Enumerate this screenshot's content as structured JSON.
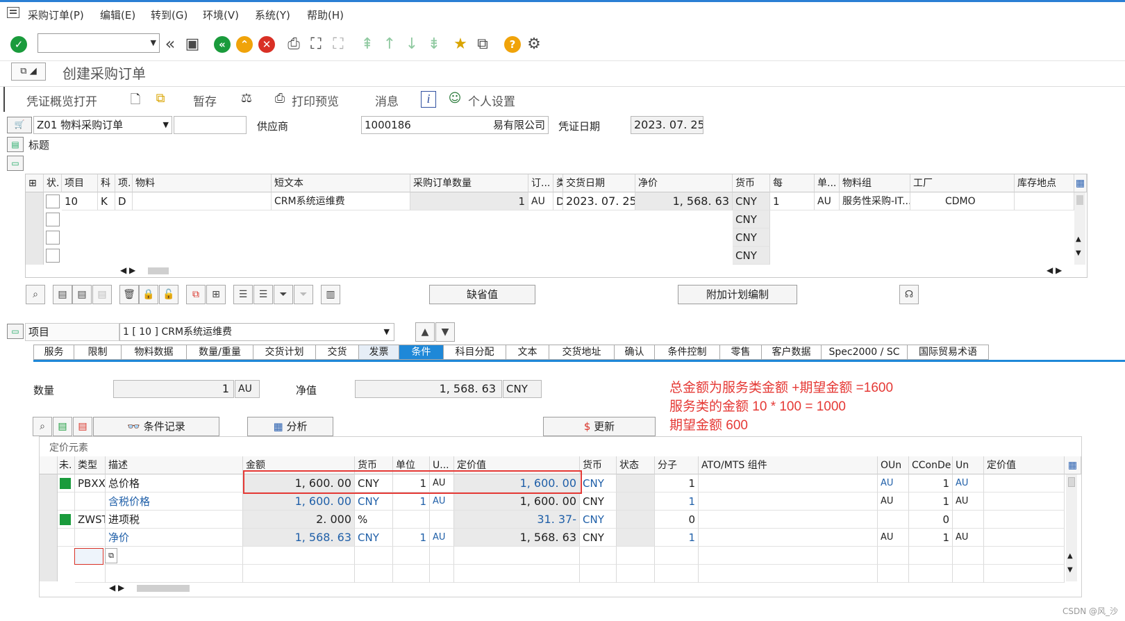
{
  "menu": [
    "采购订单(P)",
    "编辑(E)",
    "转到(G)",
    "环境(V)",
    "系统(Y)",
    "帮助(H)"
  ],
  "title": "创建采购订单",
  "appbar": {
    "overview": "凭证概览打开",
    "hold": "暂存",
    "print_preview": "打印预览",
    "messages": "消息",
    "personal": "个人设置"
  },
  "header": {
    "doc_type": "Z01 物料采购订单",
    "vendor_label": "供应商",
    "vendor_id": "1000186",
    "vendor_name": "易有限公司",
    "doc_date_label": "凭证日期",
    "doc_date": "2023. 07. 25",
    "header_label": "标题"
  },
  "items_grid": {
    "columns": [
      "状.",
      "项目",
      "科",
      "项.",
      "物料",
      "短文本",
      "采购订单数量",
      "订...",
      "类",
      "交货日期",
      "净价",
      "货币",
      "每",
      "单...",
      "物料组",
      "工厂",
      "库存地点"
    ],
    "rows": [
      {
        "item": "10",
        "acct": "K",
        "cat": "D",
        "material": "",
        "short_text": "CRM系统运维费",
        "qty": "1",
        "unit": "AU",
        "dtype": "D",
        "delivery": "2023. 07. 25",
        "net_price": "1, 568. 63",
        "currency": "CNY",
        "per": "1",
        "uom": "AU",
        "mat_group": "服务性采购-IT...",
        "plant": "CDMO"
      },
      {
        "currency": "CNY"
      },
      {
        "currency": "CNY"
      },
      {
        "currency": "CNY"
      }
    ]
  },
  "buttons": {
    "default_values": "缺省值",
    "add_planning": "附加计划编制",
    "cond_record": "条件记录",
    "analysis": "分析",
    "update": "更新"
  },
  "item_detail": {
    "label": "项目",
    "selected": "1 [ 10 ] CRM系统运维费"
  },
  "tabs": [
    "服务",
    "限制",
    "物料数据",
    "数量/重量",
    "交货计划",
    "交货",
    "发票",
    "条件",
    "科目分配",
    "文本",
    "交货地址",
    "确认",
    "条件控制",
    "零售",
    "客户数据",
    "Spec2000 / SC",
    "国际贸易术语"
  ],
  "active_tab": "条件",
  "conditions": {
    "qty_label": "数量",
    "qty": "1",
    "qty_unit": "AU",
    "net_label": "净值",
    "net_value": "1, 568. 63",
    "net_currency": "CNY",
    "pricing_label": "定价元素",
    "columns": [
      "未.",
      "类型",
      "描述",
      "金额",
      "货币",
      "单位",
      "U...",
      "定价值",
      "货币",
      "状态",
      "分子",
      "ATO/MTS 组件",
      "OUn",
      "CConDe",
      "Un",
      "定价值"
    ],
    "rows": [
      {
        "status": "green",
        "type": "PBXX",
        "desc": "总价格",
        "amount": "1, 600. 00",
        "curr": "CNY",
        "unit": "1",
        "u": "AU",
        "value": "1, 600. 00",
        "vcurr": "CNY",
        "num": "1",
        "oun": "AU",
        "ccon": "1",
        "un": "AU"
      },
      {
        "status": "",
        "type": "",
        "desc": "含税价格",
        "amount": "1, 600. 00",
        "curr": "CNY",
        "unit": "1",
        "u": "AU",
        "value": "1, 600. 00",
        "vcurr": "CNY",
        "num": "1",
        "oun": "AU",
        "ccon": "1",
        "un": "AU"
      },
      {
        "status": "green",
        "type": "ZWST",
        "desc": "进项税",
        "amount": "2. 000",
        "curr": "%",
        "unit": "",
        "u": "",
        "value": "31. 37-",
        "vcurr": "CNY",
        "num": "0",
        "oun": "",
        "ccon": "0",
        "un": ""
      },
      {
        "status": "",
        "type": "",
        "desc": "净价",
        "amount": "1, 568. 63",
        "curr": "CNY",
        "unit": "1",
        "u": "AU",
        "value": "1, 568. 63",
        "vcurr": "CNY",
        "num": "1",
        "oun": "AU",
        "ccon": "1",
        "un": "AU"
      }
    ]
  },
  "annotations": [
    "总金额为服务类金额 +期望金额 =1600",
    "服务类的金额 10 * 100 = 1000",
    "期望金额 600"
  ],
  "watermark": "CSDN @风_沙",
  "colors": {
    "accent": "#1e88d8",
    "annotation": "#e53935",
    "status_green": "#1a9b3c",
    "link_blue": "#1f5fa8"
  }
}
